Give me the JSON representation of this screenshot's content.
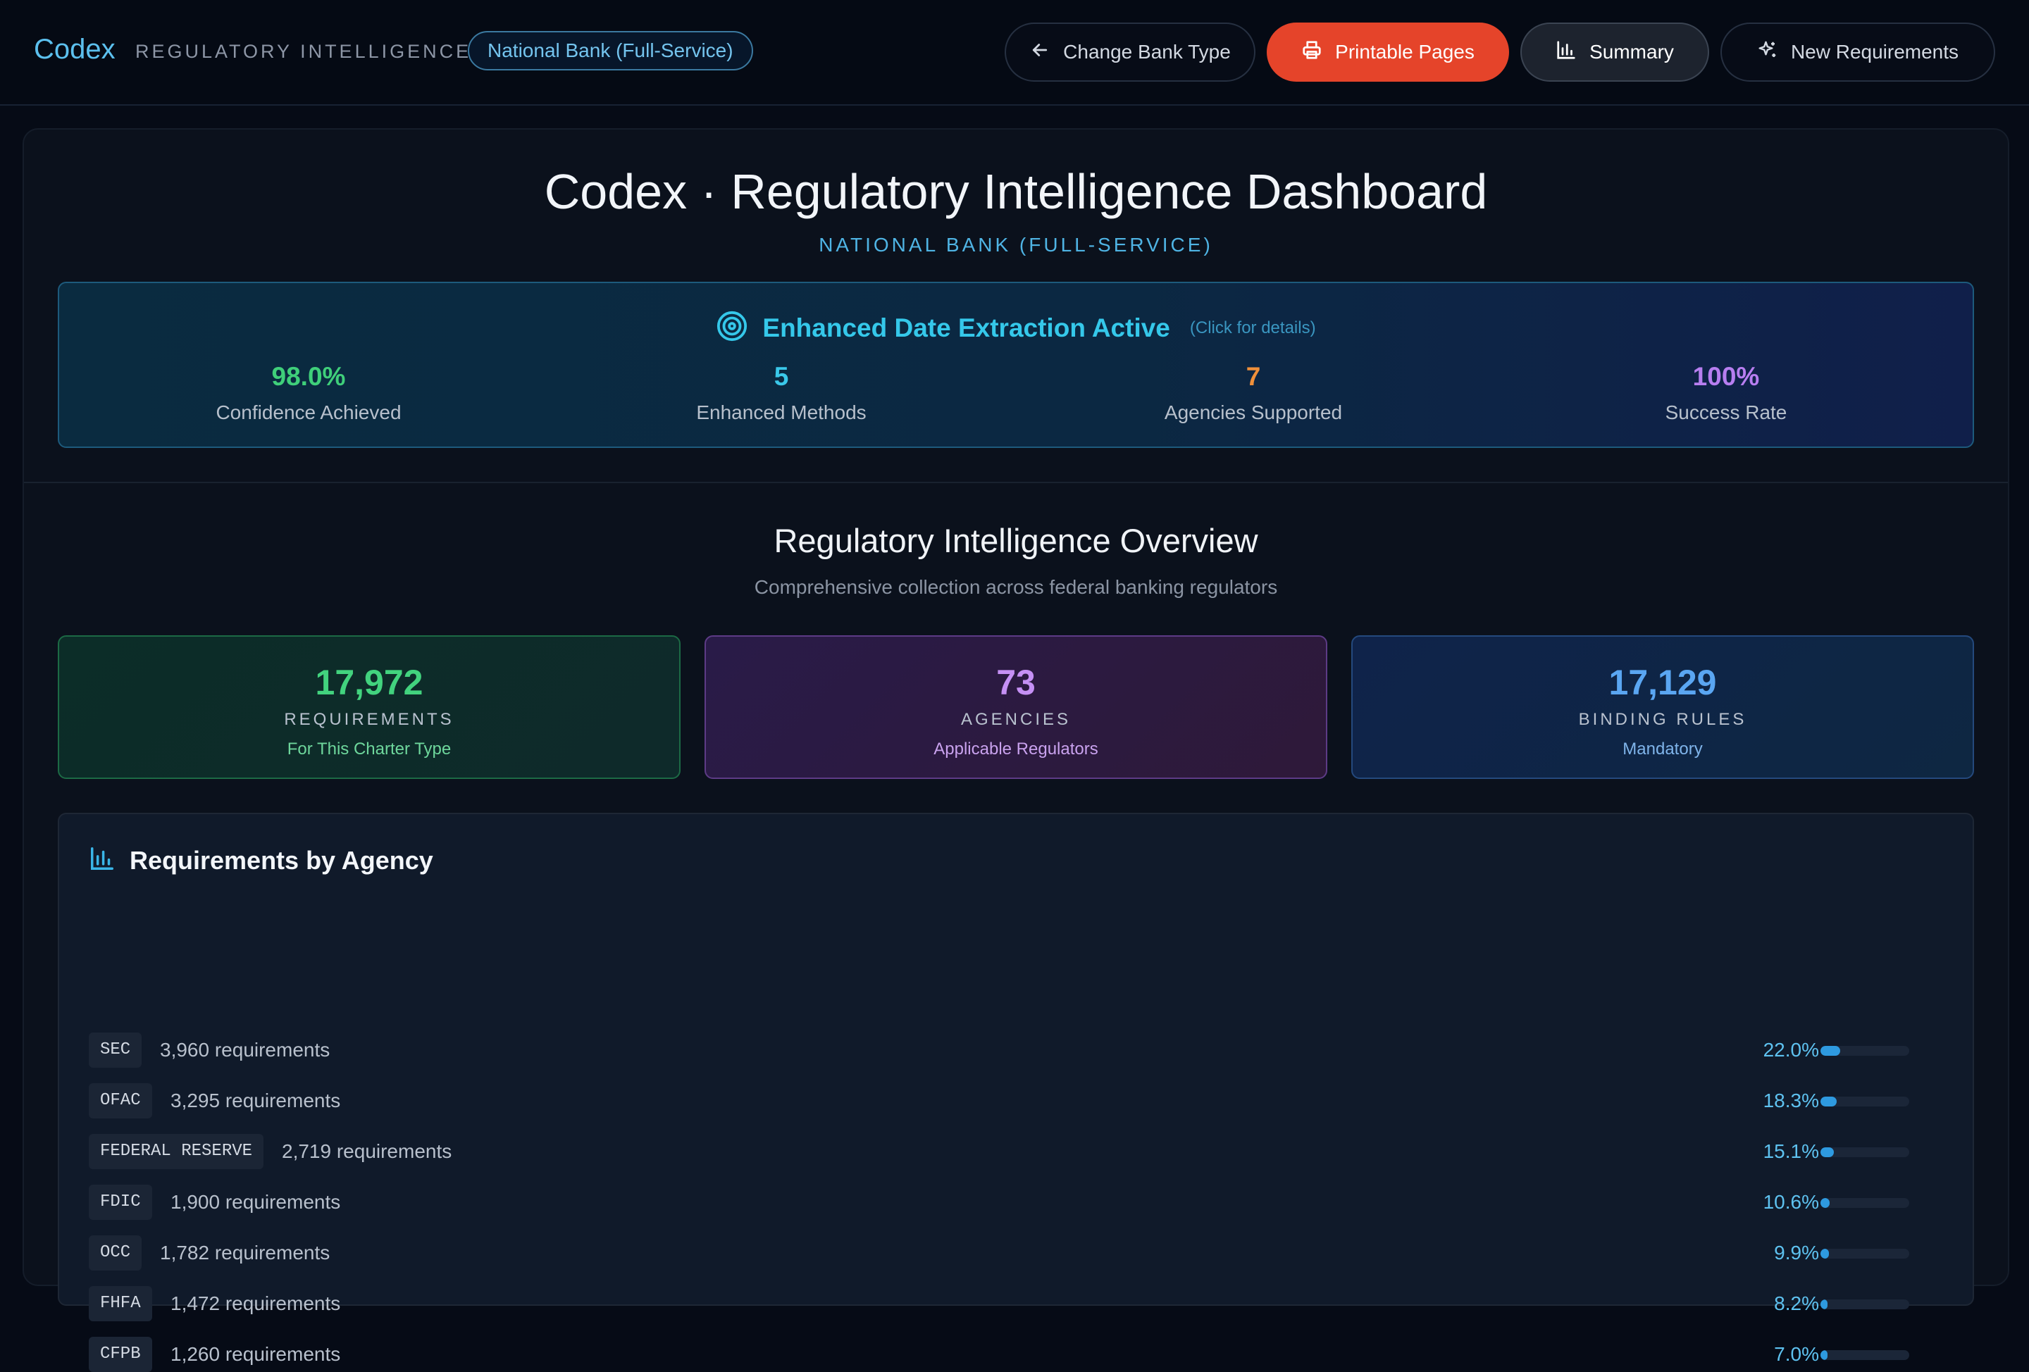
{
  "app": {
    "brand": "Codex",
    "subtitle": "REGULATORY INTELLIGENCE",
    "charter": "National Bank (Full-Service)"
  },
  "toolbar": {
    "change_label": "Change Bank Type",
    "print_label": "Printable Pages",
    "summary_label": "Summary",
    "new_label": "New Requirements"
  },
  "header": {
    "title": "Codex · Regulatory Intelligence Dashboard",
    "subtitle": "NATIONAL BANK (FULL-SERVICE)"
  },
  "extraction": {
    "title": "Enhanced Date Extraction Active",
    "hint": "(Click for details)",
    "stats": [
      {
        "value": "98.0%",
        "label": "Confidence Achieved",
        "color": "#3fcf7a"
      },
      {
        "value": "5",
        "label": "Enhanced Methods",
        "color": "#3ac8ea"
      },
      {
        "value": "7",
        "label": "Agencies Supported",
        "color": "#f0903a"
      },
      {
        "value": "100%",
        "label": "Success Rate",
        "color": "#b77ef0"
      }
    ]
  },
  "overview": {
    "title": "Regulatory Intelligence Overview",
    "subtitle": "Comprehensive collection across federal banking regulators",
    "cards": [
      {
        "number": "17,972",
        "label": "REQUIREMENTS",
        "sub": "For This Charter Type",
        "color": "#42d37e",
        "sub_color": "#6ed79c"
      },
      {
        "number": "73",
        "label": "AGENCIES",
        "sub": "Applicable Regulators",
        "color": "#c590f4",
        "sub_color": "#c9a2ee"
      },
      {
        "number": "17,129",
        "label": "BINDING RULES",
        "sub": "Mandatory",
        "color": "#5aa6f2",
        "sub_color": "#7fb4ea"
      }
    ]
  },
  "agencies": {
    "title": "Requirements by Agency",
    "rows": [
      {
        "agency": "SEC",
        "count": "3,960 requirements",
        "percent": "22.0%",
        "share": 0.22
      },
      {
        "agency": "OFAC",
        "count": "3,295 requirements",
        "percent": "18.3%",
        "share": 0.183
      },
      {
        "agency": "FEDERAL RESERVE",
        "count": "2,719 requirements",
        "percent": "15.1%",
        "share": 0.151
      },
      {
        "agency": "FDIC",
        "count": "1,900 requirements",
        "percent": "10.6%",
        "share": 0.106
      },
      {
        "agency": "OCC",
        "count": "1,782 requirements",
        "percent": "9.9%",
        "share": 0.099
      },
      {
        "agency": "FHFA",
        "count": "1,472 requirements",
        "percent": "8.2%",
        "share": 0.082
      },
      {
        "agency": "CFPB",
        "count": "1,260 requirements",
        "percent": "7.0%",
        "share": 0.07
      }
    ]
  }
}
